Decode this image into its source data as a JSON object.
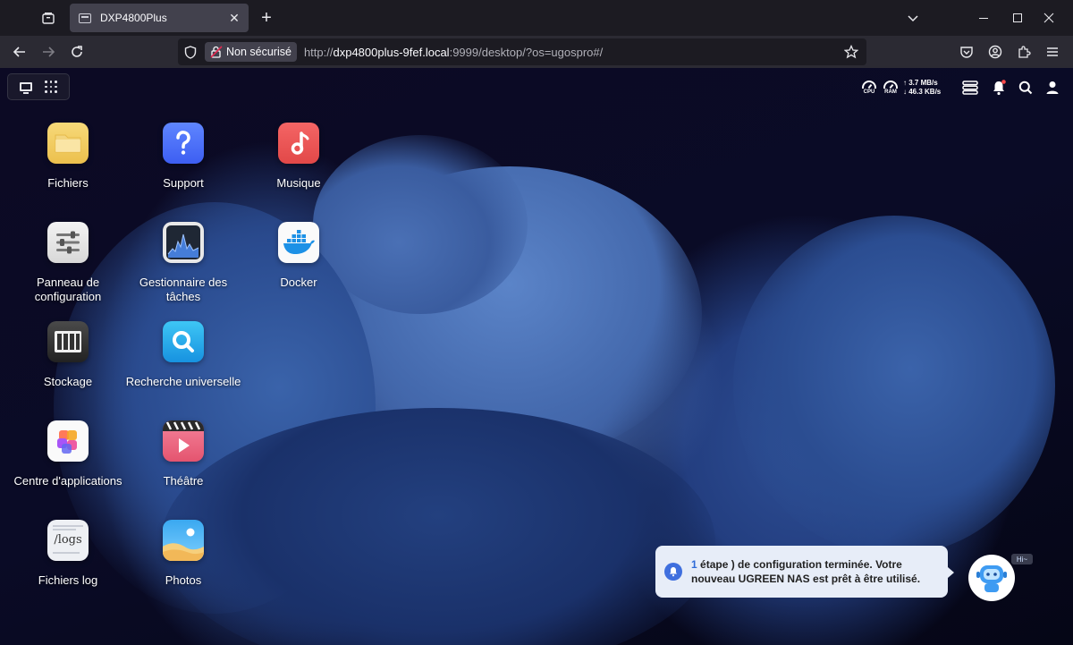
{
  "browser": {
    "tab_title": "DXP4800Plus",
    "security_label": "Non sécurisé",
    "url_prefix": "http://",
    "url_host": "dxp4800plus-9fef.local",
    "url_rest": ":9999/desktop/?os=ugospro#/"
  },
  "status": {
    "cpu_label": "CPU",
    "ram_label": "RAM",
    "upload": "↑ 3.7 MB/s",
    "download": "↓ 46.3 KB/s"
  },
  "apps": [
    {
      "label": "Fichiers",
      "icon": "folder-icon"
    },
    {
      "label": "Support",
      "icon": "help-icon"
    },
    {
      "label": "Musique",
      "icon": "music-icon"
    },
    {
      "label": "Panneau de configuration",
      "icon": "control-panel-icon"
    },
    {
      "label": "Gestionnaire des tâches",
      "icon": "task-manager-icon"
    },
    {
      "label": "Docker",
      "icon": "docker-icon"
    },
    {
      "label": "Stockage",
      "icon": "storage-icon"
    },
    {
      "label": "Recherche universelle",
      "icon": "search-app-icon"
    },
    {
      "label": "Centre d'applications",
      "icon": "app-center-icon"
    },
    {
      "label": "Théâtre",
      "icon": "theater-icon"
    },
    {
      "label": "Fichiers log",
      "icon": "logs-icon"
    },
    {
      "label": "Photos",
      "icon": "photos-icon"
    }
  ],
  "logs_tile_text": "/logs",
  "toast": {
    "count": "1",
    "message": "étape ) de configuration terminée. Votre nouveau UGREEN NAS est prêt à être utilisé."
  },
  "assistant_bubble": "Hi~",
  "colors": {
    "accent": "#3f6fde",
    "toast_bg": "#e7edf8"
  }
}
